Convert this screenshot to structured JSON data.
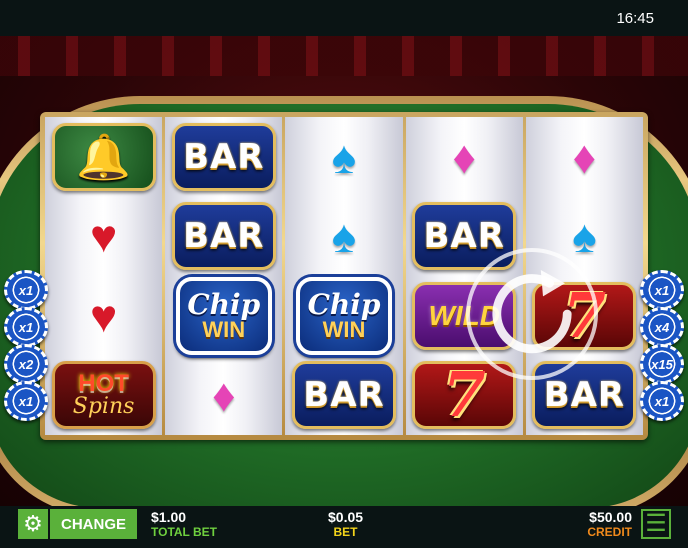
{
  "status_bar": {
    "time": "16:45"
  },
  "reels": [
    [
      {
        "symbol": "bell",
        "icon": "bell-icon",
        "glyph": "🔔"
      },
      {
        "symbol": "heart",
        "glyph": "♥"
      },
      {
        "symbol": "heart",
        "glyph": "♥"
      },
      {
        "symbol": "hot-spins",
        "line1": "HOT",
        "line2": "Spins"
      }
    ],
    [
      {
        "symbol": "bar",
        "text": "BAR"
      },
      {
        "symbol": "bar",
        "text": "BAR"
      },
      {
        "symbol": "chip-win",
        "line1": "Chip",
        "line2": "WIN"
      },
      {
        "symbol": "diamond",
        "glyph": "♦"
      }
    ],
    [
      {
        "symbol": "spade",
        "glyph": "♠"
      },
      {
        "symbol": "spade",
        "glyph": "♠"
      },
      {
        "symbol": "chip-win",
        "line1": "Chip",
        "line2": "WIN"
      },
      {
        "symbol": "bar",
        "text": "BAR"
      }
    ],
    [
      {
        "symbol": "diamond",
        "glyph": "♦"
      },
      {
        "symbol": "bar",
        "text": "BAR"
      },
      {
        "symbol": "wild",
        "text": "WILD"
      },
      {
        "symbol": "seven",
        "text": "7"
      }
    ],
    [
      {
        "symbol": "diamond",
        "glyph": "♦"
      },
      {
        "symbol": "spade",
        "glyph": "♠"
      },
      {
        "symbol": "seven",
        "text": "7"
      },
      {
        "symbol": "bar",
        "text": "BAR"
      }
    ]
  ],
  "multiplier_chips": {
    "left": [
      "x1",
      "x1",
      "x2",
      "x1"
    ],
    "right": [
      "x1",
      "x4",
      "x15",
      "x1"
    ]
  },
  "spin_button": {
    "icon": "refresh-spin-icon"
  },
  "bottom_bar": {
    "settings_icon": "gear-icon",
    "change_label": "CHANGE",
    "total_bet_value": "$1.00",
    "total_bet_label": "TOTAL BET",
    "bet_value": "$0.05",
    "bet_label": "BET",
    "credit_value": "$50.00",
    "credit_label": "CREDIT",
    "menu_icon": "hamburger-menu-icon"
  },
  "colors": {
    "felt": "#1f6a25",
    "button_green": "#5ab13a",
    "total_bet_label": "#6fd03f",
    "bet_label": "#f3d41b",
    "credit_label": "#f08a1c"
  }
}
